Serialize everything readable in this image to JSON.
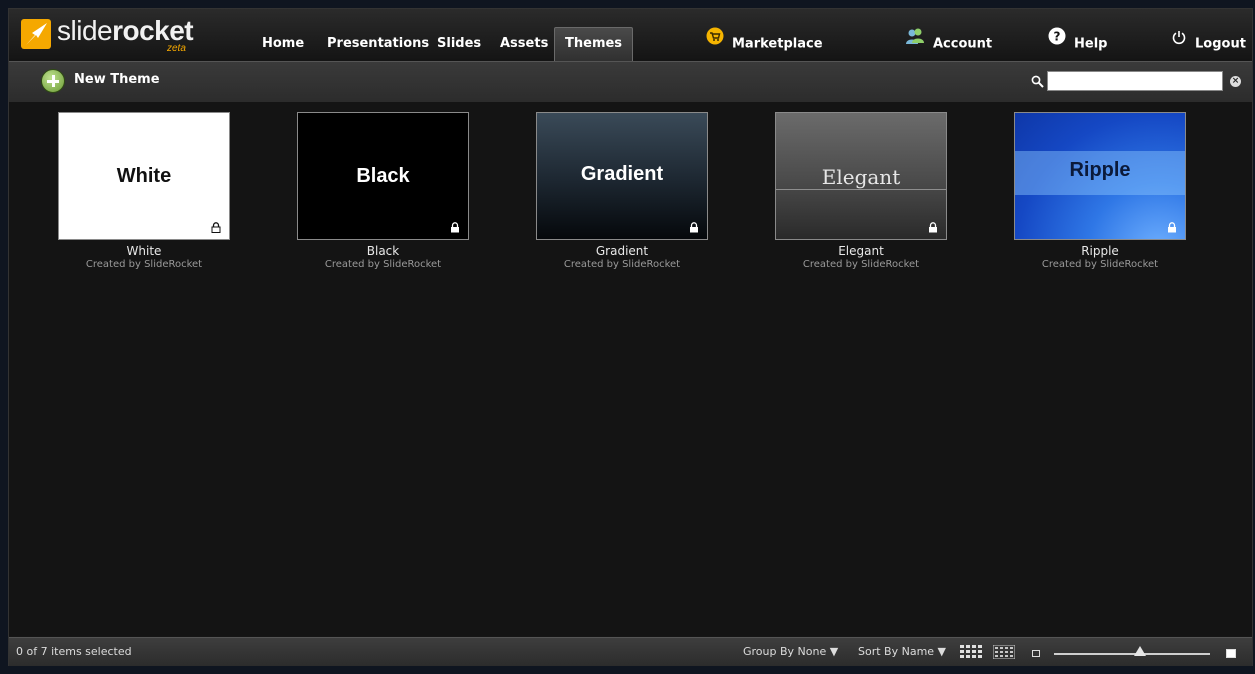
{
  "app": {
    "brand_light": "slide",
    "brand_bold": "rocket",
    "brand_tag": "zeta",
    "accent": "#f5a800"
  },
  "nav": {
    "home": "Home",
    "presentations": "Presentations",
    "slides": "Slides",
    "assets": "Assets",
    "themes": "Themes",
    "marketplace": "Marketplace",
    "account": "Account",
    "help": "Help",
    "logout": "Logout",
    "active": "Themes"
  },
  "toolbar": {
    "new_theme": "New Theme",
    "search_placeholder": "",
    "search_value": ""
  },
  "themes": [
    {
      "thumb_title": "White",
      "name": "White",
      "creator": "Created by SlideRocket",
      "bg": "#ffffff",
      "title_color": "#111111"
    },
    {
      "thumb_title": "Black",
      "name": "Black",
      "creator": "Created by SlideRocket",
      "bg": "#000000",
      "title_color": "#ffffff"
    },
    {
      "thumb_title": "Gradient",
      "name": "Gradient",
      "creator": "Created by SlideRocket",
      "bg": "#1e2a36",
      "title_color": "#ffffff"
    },
    {
      "thumb_title": "Elegant",
      "name": "Elegant",
      "creator": "Created by SlideRocket",
      "bg": "#555555",
      "title_color": "#ffffff"
    },
    {
      "thumb_title": "Ripple",
      "name": "Ripple",
      "creator": "Created by SlideRocket",
      "bg": "#1b5fd9",
      "title_color": "#0b1a3a"
    }
  ],
  "status": {
    "selection": "0 of 7 items selected",
    "group_by": "Group By None ▼",
    "sort_by": "Sort By Name ▼",
    "thumb_size": 0.55
  }
}
